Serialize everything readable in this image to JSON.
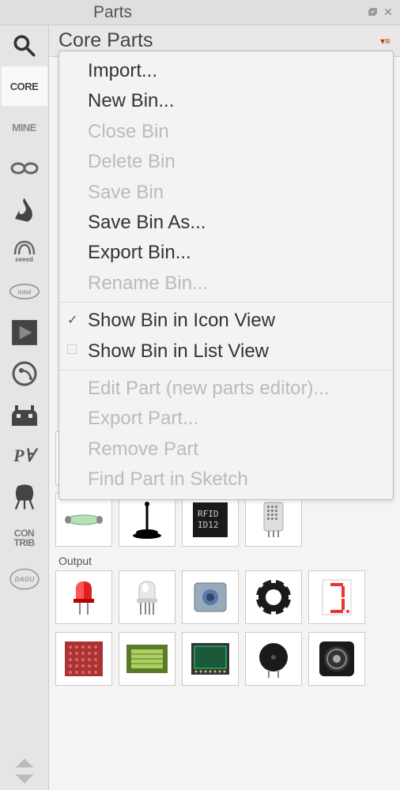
{
  "panel": {
    "title": "Parts"
  },
  "content": {
    "title": "Core Parts"
  },
  "sidebar": {
    "items": [
      {
        "label": "CORE"
      },
      {
        "label": "MINE"
      },
      {
        "label": "arduino"
      },
      {
        "label": "sparkfun"
      },
      {
        "label": "seeed"
      },
      {
        "label": "intel"
      },
      {
        "label": "play"
      },
      {
        "label": "particle"
      },
      {
        "label": "fritzing-creature"
      },
      {
        "label": "PA"
      },
      {
        "label": "transistor"
      },
      {
        "label": "CON TRIB"
      },
      {
        "label": "dagu"
      }
    ]
  },
  "menu": {
    "items": [
      {
        "label": "Import...",
        "enabled": true
      },
      {
        "label": "New Bin...",
        "enabled": true
      },
      {
        "label": "Close Bin",
        "enabled": false
      },
      {
        "label": "Delete Bin",
        "enabled": false
      },
      {
        "label": "Save Bin",
        "enabled": false
      },
      {
        "label": "Save Bin As...",
        "enabled": true
      },
      {
        "label": "Export Bin...",
        "enabled": true
      },
      {
        "label": "Rename Bin...",
        "enabled": false
      },
      {
        "label": "Show Bin in Icon View",
        "enabled": true,
        "checked": true
      },
      {
        "label": "Show Bin in List View",
        "enabled": true,
        "checked": false
      },
      {
        "label": "Edit Part (new parts editor)...",
        "enabled": false
      },
      {
        "label": "Export Part...",
        "enabled": false
      },
      {
        "label": "Remove Part",
        "enabled": false
      },
      {
        "label": "Find Part in Sketch",
        "enabled": false
      }
    ]
  },
  "sections": {
    "output": "Output"
  },
  "parts": {
    "row1": [
      "fuse",
      "antenna",
      "rfid",
      "dht-sensor",
      "blank"
    ],
    "output_row1": [
      "red-led",
      "rgb-led",
      "relay",
      "neopixel-ring",
      "seven-segment"
    ],
    "output_row2": [
      "led-matrix",
      "lcd",
      "oled",
      "buzzer",
      "speaker"
    ]
  },
  "rfid_text": {
    "line1": "RFID",
    "line2": "ID12"
  }
}
